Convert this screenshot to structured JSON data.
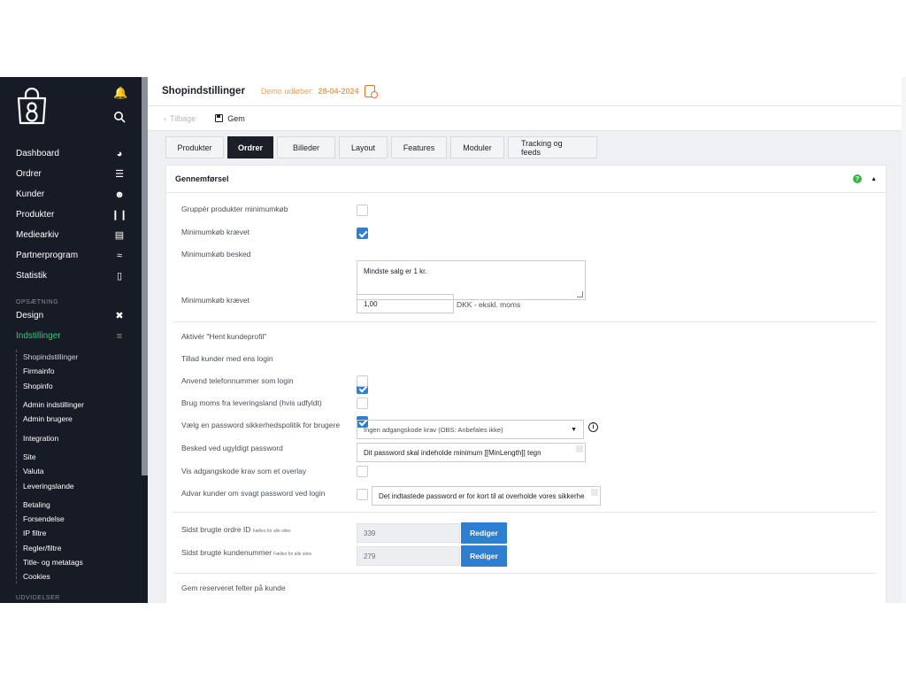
{
  "sidebar": {
    "nav": [
      {
        "label": "Dashboard",
        "icon": "gauge-icon"
      },
      {
        "label": "Ordrer",
        "icon": "list-icon"
      },
      {
        "label": "Kunder",
        "icon": "users-icon"
      },
      {
        "label": "Produkter",
        "icon": "barcode-icon"
      },
      {
        "label": "Mediearkiv",
        "icon": "archive-icon"
      },
      {
        "label": "Partnerprogram",
        "icon": "handshake-icon"
      },
      {
        "label": "Statistik",
        "icon": "chart-icon"
      }
    ],
    "section_setup": "OPSÆTNING",
    "setup": [
      {
        "label": "Design",
        "icon": "tools-icon"
      },
      {
        "label": "Indstillinger",
        "icon": "sliders-icon"
      }
    ],
    "sub_group_1": [
      "Shopindstillinger",
      "Firmainfo",
      "Shopinfo"
    ],
    "sub_group_2": [
      "Admin indstillinger",
      "Admin brugere"
    ],
    "sub_group_3": [
      "Integration"
    ],
    "sub_group_4": [
      "Site",
      "Valuta",
      "Leveringslande"
    ],
    "sub_group_5": [
      "Betaling",
      "Forsendelse",
      "IP filtre",
      "Regler/filtre",
      "Title- og metatags",
      "Cookies"
    ],
    "section_extensions": "UDVIDELSER"
  },
  "header": {
    "title": "Shopindstillinger",
    "demo_label": "Demo udløber:",
    "demo_date": "28-04-2024"
  },
  "toolbar": {
    "back_label": "Tilbage",
    "save_label": "Gem"
  },
  "tabs": [
    "Produkter",
    "Ordrer",
    "Billeder",
    "Layout",
    "Features",
    "Moduler",
    "Tracking og feeds"
  ],
  "active_tab": "Ordrer",
  "panel": {
    "title": "Gennemførsel",
    "help": "?",
    "rows": {
      "group_min": "Gruppér produkter minimumkøb",
      "min_required_1": "Minimumkøb krævet",
      "min_message": "Minimumkøb besked",
      "min_message_value": "Mindste salg er 1 kr.",
      "min_required_2": "Minimumkøb krævet",
      "min_amount": "1,00",
      "min_unit": "DKK - ekskl. moms",
      "hent_profile": "Aktivér \"Hent kundeprofil\"",
      "same_login": "Tillad kunder med ens login",
      "phone_login": "Anvend telefonnummer som login",
      "vat_country": "Brug moms fra leveringsland (hvis udfyldt)",
      "pw_policy": "Vælg en password sikkerhedspolitik for brugere",
      "pw_policy_value": "Ingen adgangskode krav (OBS: Anbefales ikke)",
      "pw_invalid": "Besked ved ugyldigt password",
      "pw_invalid_value": "Dit password skal indeholde minimum [[MinLength]] tegn",
      "pw_overlay": "Vis adgangskode krav som et overlay",
      "pw_weak": "Advar kunder om svagt password ved login",
      "pw_weak_value": "Det indtastede password er for kort til at overholde vores sikkerhe",
      "last_order_id": "Sidst brugte ordre ID",
      "last_order_note": "Fælles for alle sites",
      "last_order_value": "339",
      "last_customer": "Sidst brugte kundenummer",
      "last_customer_note": "Fælles for alle sites",
      "last_customer_value": "279",
      "edit_label": "Rediger",
      "reserved_fields": "Gem reserveret felter på kunde"
    },
    "checkboxes": {
      "group_min": false,
      "min_required_1": true,
      "hent_profile": true,
      "same_login": true,
      "phone_login": false,
      "vat_country": false,
      "pw_overlay": false,
      "pw_weak": false,
      "reserved_fields": true
    }
  },
  "colors": {
    "sidebar_bg": "#161b26",
    "accent_green": "#3fc37a",
    "primary_blue": "#2f7fd1",
    "demo_orange": "#e8a25a"
  }
}
